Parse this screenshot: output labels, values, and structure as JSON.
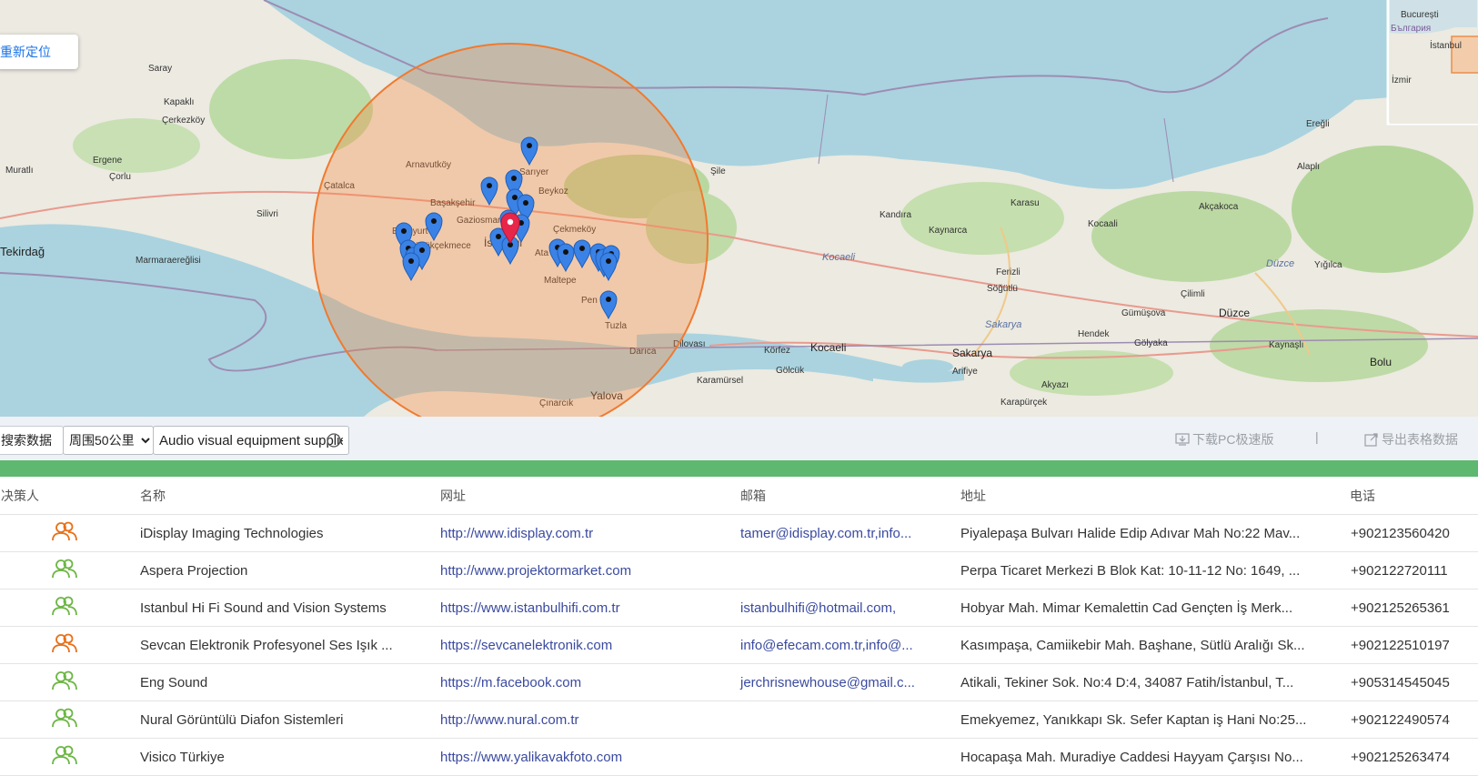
{
  "map": {
    "relocate_label": "重新定位",
    "place_labels": {
      "bucuresti": "București",
      "bulgaria": "България",
      "istanbul_mini": "İstanbul",
      "izmir": "İzmir",
      "saray": "Saray",
      "kapakli": "Kapaklı",
      "cerkezkoy": "Çerkezköy",
      "muratli": "Muratlı",
      "ergene": "Ergene",
      "corlu": "Çorlu",
      "tekirdag": "Tekirdağ",
      "marmaraereglisi": "Marmaraereğlisi",
      "silivri": "Silivri",
      "catalca": "Çatalca",
      "arnavutkoy": "Arnavutköy",
      "sariyer": "Sarıyer",
      "beykoz": "Beykoz",
      "basaksehir": "Başakşehir",
      "gaziosmanpasa": "Gaziosman",
      "esenyurt": "Esenyurt",
      "buyukcekmece": "Büyükçekmece",
      "istanbul": "İstanbul",
      "cekmekoy": "Çekmeköy",
      "atasehir": "Ata",
      "maltepe": "Maltepe",
      "pendik": "Pen",
      "tuzla": "Tuzla",
      "darica": "Darıca",
      "yalova": "Yalova",
      "cinarcik": "Çınarcık",
      "sile": "Şile",
      "karasu": "Karasu",
      "akcakoca": "Akçakoca",
      "kandira": "Kandıra",
      "kaynarca": "Kaynarca",
      "kocaali": "Kocaali",
      "kocaeli_region": "Kocaeli",
      "kocaeli": "Kocaeli",
      "korfez": "Körfez",
      "golcuk": "Gölcük",
      "karamursel": "Karamürsel",
      "dilovasi": "Dilovası",
      "ferizli": "Ferizli",
      "sogutlu": "Söğütlü",
      "sakarya_region": "Sakarya",
      "sakarya": "Sakarya",
      "arifiye": "Arifiye",
      "akyazi": "Akyazı",
      "karapurcek": "Karapürçek",
      "hendek": "Hendek",
      "cilimli": "Çilimli",
      "gumusova": "Gümüşova",
      "duzce_region": "Düzce",
      "duzce": "Düzce",
      "yigilca": "Yığılca",
      "golyaka": "Gölyaka",
      "kaynasli": "Kaynaşlı",
      "bolu": "Bolu",
      "eregli": "Ereğli",
      "alapli": "Alaplı"
    }
  },
  "toolbar": {
    "search_data_label": "搜索数据",
    "radius_selected": "周围50公里",
    "keyword_value": "Audio visual equipment supplier",
    "download_label": "下载PC极速版",
    "separator": "|",
    "export_label": "导出表格数据"
  },
  "table": {
    "headers": {
      "decision_maker": "决策人",
      "name": "名称",
      "website": "网址",
      "email": "邮箱",
      "address": "地址",
      "phone": "电话"
    },
    "rows": [
      {
        "name": "iDisplay Imaging Technologies",
        "website": "http://www.idisplay.com.tr",
        "email": "tamer@idisplay.com.tr,info...",
        "address": "Piyalepaşa Bulvarı Halide Edip Adıvar Mah No:22 Mav...",
        "phone": "+902123560420",
        "decision_color": "#e8701a"
      },
      {
        "name": "Aspera Projection",
        "website": "http://www.projektormarket.com",
        "email": "",
        "address": "Perpa Ticaret Merkezi B Blok Kat: 10-11-12 No: 1649, ...",
        "phone": "+902122720111",
        "decision_color": "#6cb644"
      },
      {
        "name": "Istanbul Hi Fi Sound and Vision Systems",
        "website": "https://www.istanbulhifi.com.tr",
        "email": "istanbulhifi@hotmail.com,",
        "address": "Hobyar Mah. Mimar Kemalettin Cad Gençten İş Merk...",
        "phone": "+902125265361",
        "decision_color": "#6cb644"
      },
      {
        "name": "Sevcan Elektronik Profesyonel Ses Işık ...",
        "website": "https://sevcanelektronik.com",
        "email": "info@efecam.com.tr,info@...",
        "address": "Kasımpaşa, Camiikebir Mah. Başhane, Sütlü Aralığı Sk...",
        "phone": "+902122510197",
        "decision_color": "#e8701a"
      },
      {
        "name": "Eng Sound",
        "website": "https://m.facebook.com",
        "email": "jerchrisnewhouse@gmail.c...",
        "address": "Atikali, Tekiner Sok. No:4 D:4, 34087 Fatih/İstanbul, T...",
        "phone": "+905314545045",
        "decision_color": "#6cb644"
      },
      {
        "name": "Nural Görüntülü Diafon Sistemleri",
        "website": "http://www.nural.com.tr",
        "email": "",
        "address": "Emekyemez, Yanıkkapı Sk. Sefer Kaptan iş Hani No:25...",
        "phone": "+902122490574",
        "decision_color": "#6cb644"
      },
      {
        "name": "Visico Türkiye",
        "website": "https://www.yalikavakfoto.com",
        "email": "",
        "address": "Hocapaşa Mah. Muradiye Caddesi Hayyam Çarşısı No...",
        "phone": "+902125263474",
        "decision_color": "#6cb644"
      }
    ]
  }
}
